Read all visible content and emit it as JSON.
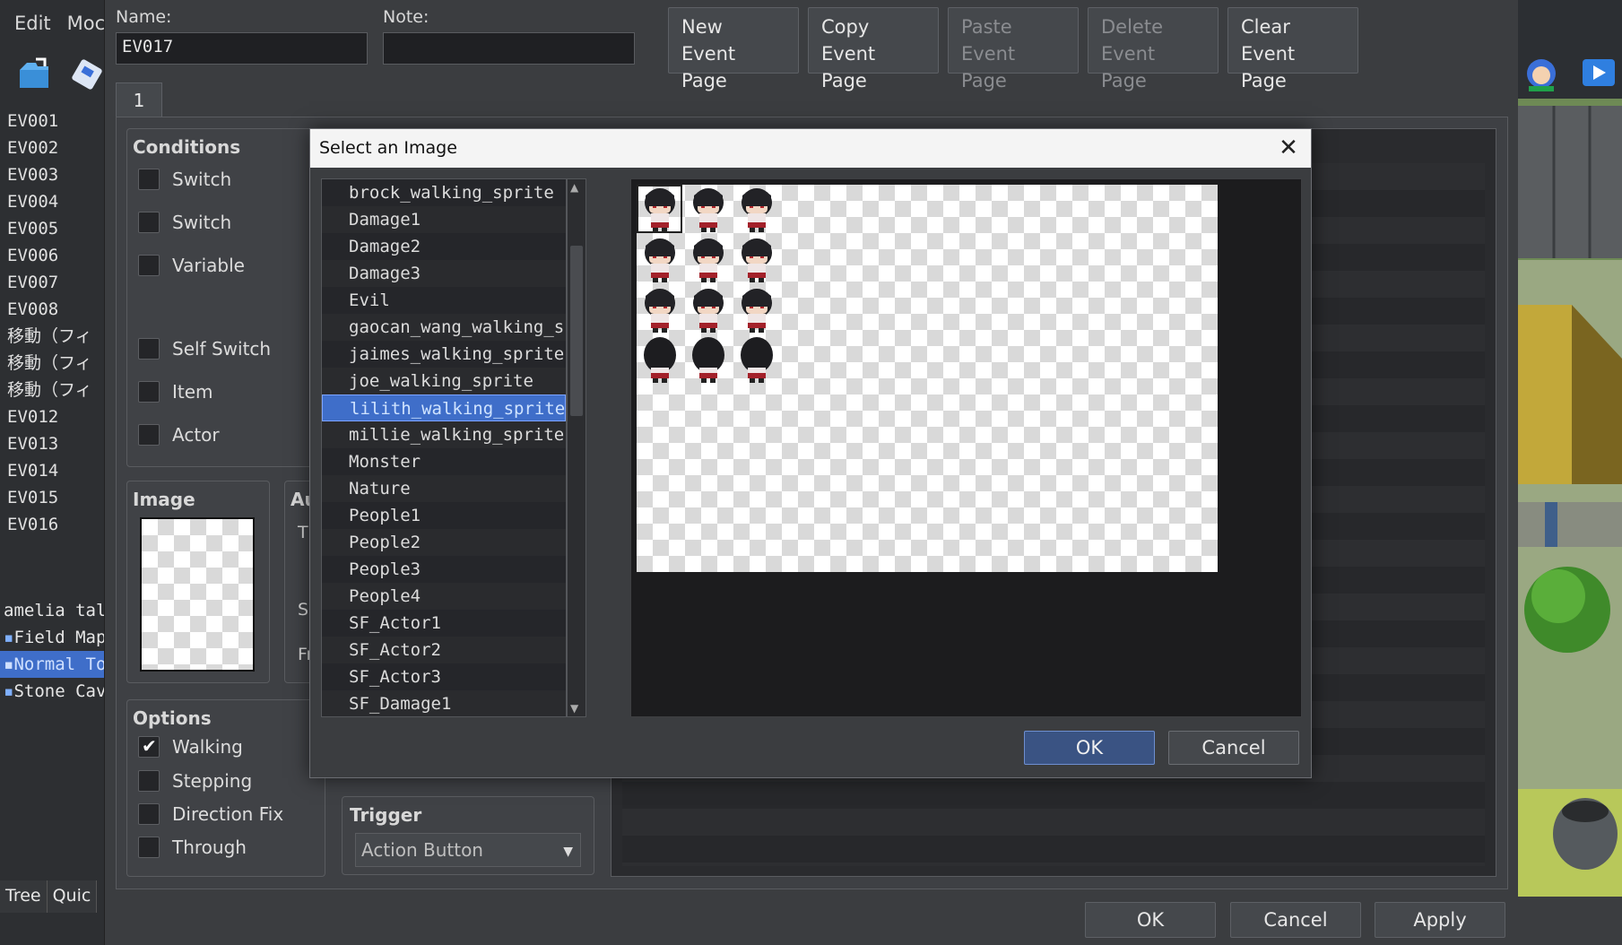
{
  "menubar": [
    "Edit",
    "Moc"
  ],
  "events": [
    "EV001",
    "EV002",
    "EV003",
    "EV004",
    "EV005",
    "EV006",
    "EV007",
    "EV008",
    "移動（フィ",
    "移動（フィ",
    "移動（フィ",
    "EV012",
    "EV013",
    "EV014",
    "EV015",
    "EV016"
  ],
  "maps": [
    {
      "label": "amelia talk",
      "icon": "",
      "selected": false
    },
    {
      "label": "Field Map",
      "icon": "map-icon",
      "selected": false
    },
    {
      "label": "Normal Tow",
      "icon": "map-icon",
      "selected": true
    },
    {
      "label": "Stone Cave",
      "icon": "map-icon",
      "selected": false
    }
  ],
  "bottom_tabs": [
    "Tree",
    "Quic"
  ],
  "editor": {
    "name_label": "Name:",
    "name_value": "EV017",
    "note_label": "Note:",
    "note_value": "",
    "page_buttons": [
      {
        "line1": "New",
        "line2": "Event Page",
        "enabled": true
      },
      {
        "line1": "Copy",
        "line2": "Event Page",
        "enabled": true
      },
      {
        "line1": "Paste",
        "line2": "Event Page",
        "enabled": false
      },
      {
        "line1": "Delete",
        "line2": "Event Page",
        "enabled": false
      },
      {
        "line1": "Clear",
        "line2": "Event Page",
        "enabled": true
      }
    ],
    "page_tab": "1",
    "conditions": {
      "title": "Conditions",
      "items": [
        "Switch",
        "Switch",
        "Variable",
        "Self Switch",
        "Item",
        "Actor"
      ]
    },
    "image": {
      "title": "Image"
    },
    "autonomous": {
      "title_fragment": "Au",
      "frag_t": "T",
      "frag_sp": "Sp",
      "frag_fr": "Fr"
    },
    "options": {
      "title": "Options",
      "items": [
        {
          "label": "Walking",
          "checked": true
        },
        {
          "label": "Stepping",
          "checked": false
        },
        {
          "label": "Direction Fix",
          "checked": false
        },
        {
          "label": "Through",
          "checked": false
        }
      ]
    },
    "trigger": {
      "title": "Trigger",
      "value": "Action Button"
    },
    "footer_buttons": {
      "ok": "OK",
      "cancel": "Cancel",
      "apply": "Apply"
    }
  },
  "dialog": {
    "title": "Select an Image",
    "files": [
      "brock_walking_sprite",
      "Damage1",
      "Damage2",
      "Damage3",
      "Evil",
      "gaocan_wang_walking_spr…",
      "jaimes_walking_sprite",
      "joe_walking_sprite",
      "lilith_walking_sprite",
      "millie_walking_sprite",
      "Monster",
      "Nature",
      "People1",
      "People2",
      "People3",
      "People4",
      "SF_Actor1",
      "SF_Actor2",
      "SF_Actor3",
      "SF_Damage1"
    ],
    "selected_index": 8,
    "ok": "OK",
    "cancel": "Cancel"
  },
  "colors": {
    "accent": "#3f6ec9",
    "bg": "#3b3d40",
    "dark": "#1f2023"
  }
}
